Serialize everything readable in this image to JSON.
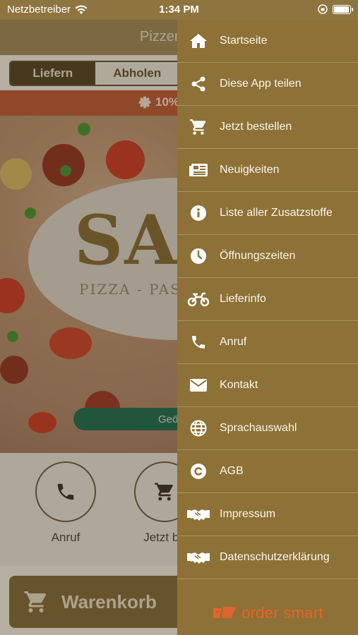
{
  "status_bar": {
    "carrier": "Netzbetreiber",
    "time": "1:34 PM"
  },
  "app": {
    "title": "Pizzer",
    "segments": [
      "Liefern",
      "Abholen"
    ],
    "promo": "10%",
    "logo_text": "SA",
    "logo_sub": "PIZZA - PAS",
    "open_label": "Geö",
    "actions": [
      {
        "label": "Anruf",
        "icon": "phone-icon"
      },
      {
        "label": "Jetzt be",
        "icon": "cart-icon"
      }
    ],
    "cart_label": "Warenkorb"
  },
  "menu": {
    "items": [
      {
        "label": "Startseite",
        "icon": "home-icon"
      },
      {
        "label": "Diese App teilen",
        "icon": "share-icon"
      },
      {
        "label": "Jetzt bestellen",
        "icon": "cart-icon"
      },
      {
        "label": "Neuigkeiten",
        "icon": "news-icon"
      },
      {
        "label": "Liste aller Zusatzstoffe",
        "icon": "info-icon"
      },
      {
        "label": "Öffnungszeiten",
        "icon": "clock-icon"
      },
      {
        "label": "Lieferinfo",
        "icon": "motorbike-icon"
      },
      {
        "label": "Anruf",
        "icon": "phone-icon"
      },
      {
        "label": "Kontakt",
        "icon": "mail-icon"
      },
      {
        "label": "Sprachauswahl",
        "icon": "globe-icon"
      },
      {
        "label": "AGB",
        "icon": "copyright-icon"
      },
      {
        "label": "Impressum",
        "icon": "handshake-icon"
      },
      {
        "label": "Datenschutzerklärung",
        "icon": "handshake-icon"
      }
    ],
    "brand": "order smart"
  },
  "colors": {
    "drawer_bg": "#8d7136",
    "accent": "#e8632c",
    "open_pill": "#10674e"
  }
}
